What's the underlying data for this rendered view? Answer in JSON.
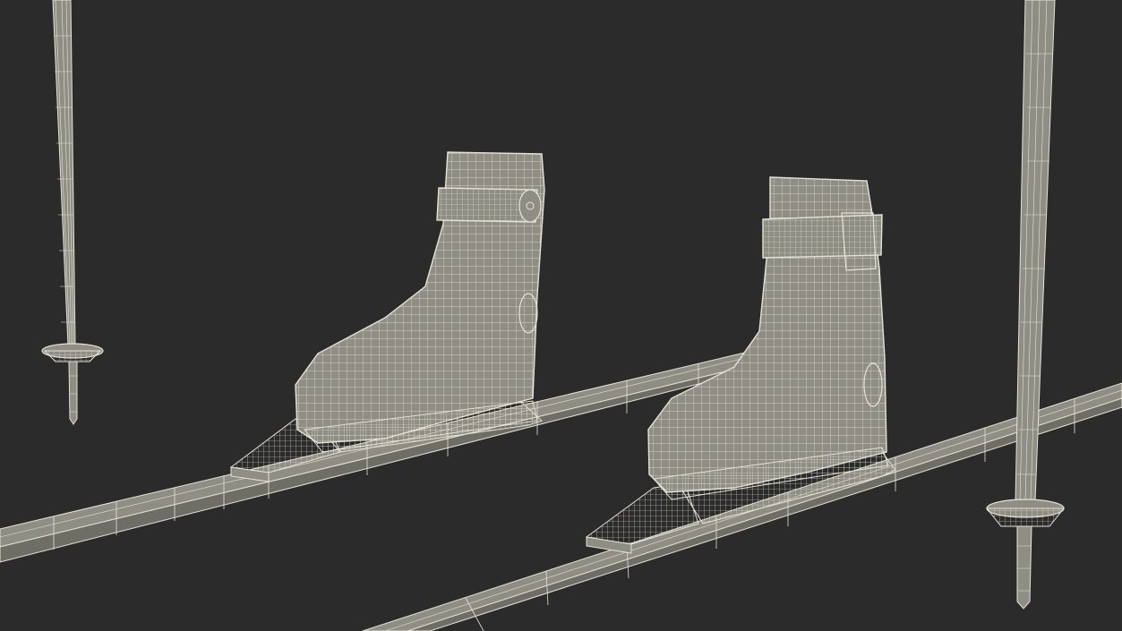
{
  "scene": {
    "background": "#2b2b2b",
    "surface_color": "#8f8e84",
    "wire_color": "#e6e3d6",
    "objects": [
      "ski-pole-left",
      "ski-left",
      "ski-boot-left",
      "ski-right",
      "ski-boot-right",
      "ski-pole-right"
    ]
  }
}
